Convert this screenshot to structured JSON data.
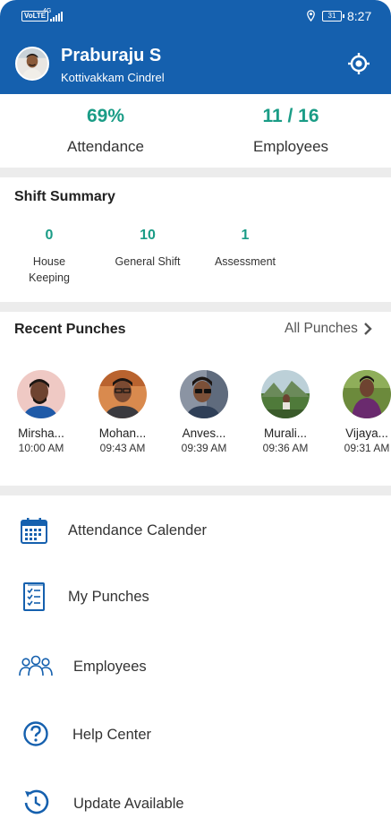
{
  "status_bar": {
    "volte": "VoLTE",
    "network": "4G",
    "battery": "31",
    "time": "8:27"
  },
  "header": {
    "user_name": "Praburaju S",
    "location": "Kottivakkam Cindrel",
    "locate_icon": "crosshair-icon",
    "brand_color": "#1560ae"
  },
  "stats": {
    "attendance_value": "69%",
    "attendance_label": "Attendance",
    "employees_value": "11 / 16",
    "employees_label": "Employees",
    "accent_color": "#1a9c86"
  },
  "shift_summary": {
    "title": "Shift Summary",
    "items": [
      {
        "value": "0",
        "label": "House\nKeeping"
      },
      {
        "value": "10",
        "label": "General Shift"
      },
      {
        "value": "1",
        "label": "Assessment"
      }
    ]
  },
  "recent_punches": {
    "title": "Recent Punches",
    "all_label": "All Punches",
    "items": [
      {
        "name": "Mirsha...",
        "time": "10:00 AM"
      },
      {
        "name": "Mohan...",
        "time": "09:43 AM"
      },
      {
        "name": "Anves...",
        "time": "09:39 AM"
      },
      {
        "name": "Murali...",
        "time": "09:36 AM"
      },
      {
        "name": "Vijaya...",
        "time": "09:31 AM"
      }
    ]
  },
  "menu": [
    {
      "label": "Attendance Calender",
      "icon": "calendar-icon"
    },
    {
      "label": "My Punches",
      "icon": "checklist-icon"
    },
    {
      "label": "Employees",
      "icon": "group-icon"
    },
    {
      "label": "Help Center",
      "icon": "help-icon"
    },
    {
      "label": "Update Available",
      "icon": "update-icon"
    }
  ]
}
